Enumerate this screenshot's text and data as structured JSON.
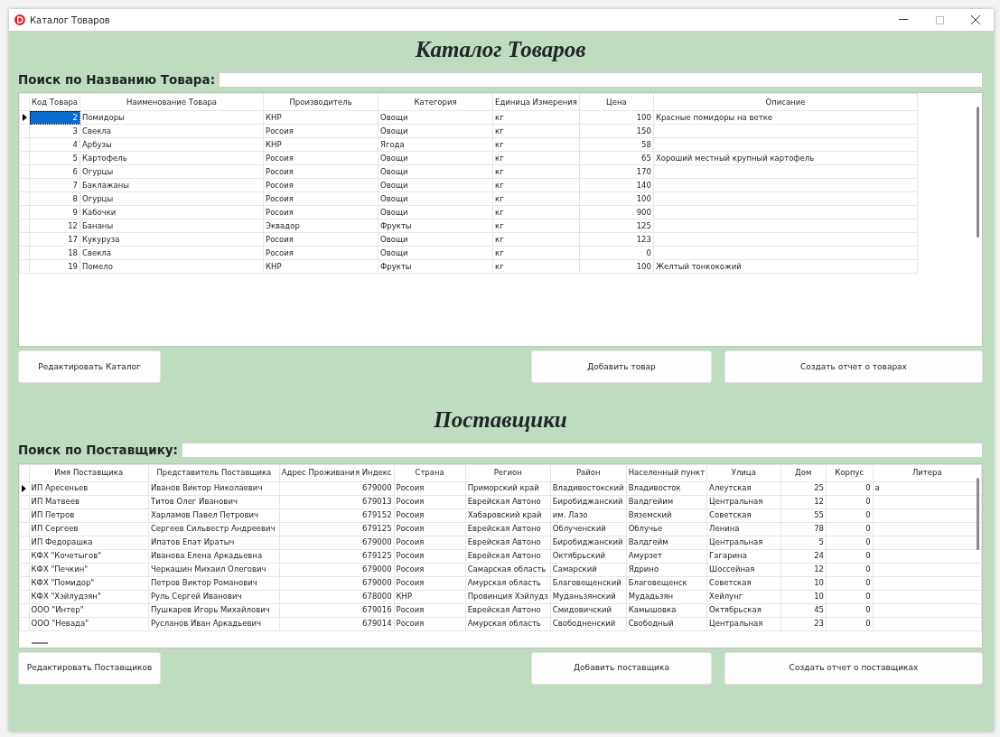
{
  "window": {
    "title": "Каталог Товаров"
  },
  "products": {
    "heading": "Каталог Товаров",
    "search_label": "Поиск по Названию Товара:",
    "active_cell_highlighted": true,
    "columns": [
      {
        "label": "Код Товара"
      },
      {
        "label": "Наименование Товара"
      },
      {
        "label": "Производитель"
      },
      {
        "label": "Категория"
      },
      {
        "label": "Единица Измерения"
      },
      {
        "label": "Цена"
      },
      {
        "label": "Описание"
      }
    ],
    "rows": [
      {
        "selected": true,
        "cells": [
          "2",
          "Помидоры",
          "КНР",
          "Овощи",
          "кг",
          "100",
          "Красные помидоры на ветке"
        ]
      },
      {
        "selected": false,
        "cells": [
          "3",
          "Свекла",
          "Росоия",
          "Овощи",
          "кг",
          "150",
          ""
        ]
      },
      {
        "selected": false,
        "cells": [
          "4",
          "Арбузы",
          "КНР",
          "Ягода",
          "кг",
          "58",
          ""
        ]
      },
      {
        "selected": false,
        "cells": [
          "5",
          "Картофель",
          "Росоия",
          "Овощи",
          "кг",
          "65",
          "Хороший местный крупный картофель"
        ]
      },
      {
        "selected": false,
        "cells": [
          "6",
          "Огурцы",
          "Росоия",
          "Овощи",
          "кг",
          "170",
          ""
        ]
      },
      {
        "selected": false,
        "cells": [
          "7",
          "Баклажаны",
          "Росоия",
          "Овощи",
          "кг",
          "140",
          ""
        ]
      },
      {
        "selected": false,
        "cells": [
          "8",
          "Огурцы",
          "Росоия",
          "Овощи",
          "кг",
          "100",
          ""
        ]
      },
      {
        "selected": false,
        "cells": [
          "9",
          "Кабочки",
          "Росоия",
          "Овощи",
          "кг",
          "900",
          ""
        ]
      },
      {
        "selected": false,
        "cells": [
          "12",
          "Бананы",
          "Эквадор",
          "Фрукты",
          "кг",
          "125",
          ""
        ]
      },
      {
        "selected": false,
        "cells": [
          "17",
          "Кукуруза",
          "Росоия",
          "Овощи",
          "кг",
          "123",
          ""
        ]
      },
      {
        "selected": false,
        "cells": [
          "18",
          "Свекла",
          "Росоия",
          "Овощи",
          "кг",
          "0",
          ""
        ]
      },
      {
        "selected": false,
        "cells": [
          "19",
          "Помело",
          "КНР",
          "Фрукты",
          "кг",
          "100",
          "Желтый тонкокожий"
        ]
      }
    ],
    "buttons": [
      "Редактировать Каталог",
      "Добавить товар",
      "Создать отчет о товарах"
    ]
  },
  "suppliers": {
    "heading": "Поставщики",
    "search_label": "Поиск по Поставщику:",
    "active_cell_highlighted": false,
    "columns": [
      {
        "label": "Имя Поставщика"
      },
      {
        "label": "Представитель Поставщика"
      },
      {
        "label": "Адрес Проживания Индекс"
      },
      {
        "label": "Страна"
      },
      {
        "label": "Регион"
      },
      {
        "label": "Район"
      },
      {
        "label": "Населенный пункт"
      },
      {
        "label": "Улица"
      },
      {
        "label": "Дом"
      },
      {
        "label": "Корпус"
      },
      {
        "label": "Литера"
      }
    ],
    "rows": [
      {
        "selected": true,
        "cells": [
          "ИП Аресеньев",
          "Иванов Виктор Николаевич",
          "679000",
          "Росоия",
          "Приморский край",
          "Владивостокский",
          "Владивосток",
          "Алеутская",
          "25",
          "0",
          "а"
        ]
      },
      {
        "selected": false,
        "cells": [
          "ИП Матвеев",
          "Титов Олег Иванович",
          "679013",
          "Росоия",
          "Еврейская Автоно",
          "Биробиджанский",
          "Валдгейим",
          "Центральная",
          "12",
          "0",
          ""
        ]
      },
      {
        "selected": false,
        "cells": [
          "ИП Петров",
          "Харламов Павел Петрович",
          "679152",
          "Росоия",
          "Хабаровский край",
          "им. Лазо",
          "Вяземский",
          "Советская",
          "55",
          "0",
          ""
        ]
      },
      {
        "selected": false,
        "cells": [
          "ИП Сергеев",
          "Сергеев Сильвестр Андреевич",
          "679125",
          "Росоия",
          "Еврейская Автоно",
          "Облученский",
          "Облучье",
          "Ленина",
          "78",
          "0",
          ""
        ]
      },
      {
        "selected": false,
        "cells": [
          "ИП Федорашка",
          "Ипатов Епат Иратыч",
          "679000",
          "Росоия",
          "Еврейская Автоно",
          "Биробиджанский",
          "Валдгейм",
          "Центральная",
          "5",
          "0",
          ""
        ]
      },
      {
        "selected": false,
        "cells": [
          "КФХ \"Кочетыгов\"",
          "Иванова Елена Аркадьевна",
          "679125",
          "Росоия",
          "Еврейская Автоно",
          "Октябрьский",
          "Амурзет",
          "Гагарина",
          "24",
          "0",
          ""
        ]
      },
      {
        "selected": false,
        "cells": [
          "КФХ \"Печкин\"",
          "Черкашин Михаил Олегович",
          "679000",
          "Росоия",
          "Самарская область",
          "Самарский",
          "Ядрино",
          "Шоссейная",
          "12",
          "0",
          ""
        ]
      },
      {
        "selected": false,
        "cells": [
          "КФХ \"Помидор\"",
          "Петров Виктор Романович",
          "679000",
          "Росоия",
          "Амурская область",
          "Благовещенский",
          "Благовещенск",
          "Советская",
          "10",
          "0",
          ""
        ]
      },
      {
        "selected": false,
        "cells": [
          "КФХ \"Хэйлудзян\"",
          "Руль Сергей Иванович",
          "678000",
          "КНР",
          "Провинция Хэйлудз",
          "Муданьзянский",
          "Мудадьзян",
          "Хейлунг",
          "10",
          "0",
          ""
        ]
      },
      {
        "selected": false,
        "cells": [
          "ООО \"Интер\"",
          "Пушкарев Игорь Михайлович",
          "679016",
          "Росоия",
          "Еврейская Автоно",
          "Смидовичский",
          "Камышовка",
          "Октябрьская",
          "45",
          "0",
          ""
        ]
      },
      {
        "selected": false,
        "cells": [
          "ООО \"Невада\"",
          "Русланов Иван Аркадьевич",
          "679014",
          "Росоия",
          "Амурская область",
          "Свободненский",
          "Свободный",
          "Центральная",
          "23",
          "0",
          ""
        ]
      }
    ],
    "buttons": [
      "Редактировать Поставщиков",
      "Добавить поставщика",
      "Создать отчет о поставщиках"
    ]
  }
}
